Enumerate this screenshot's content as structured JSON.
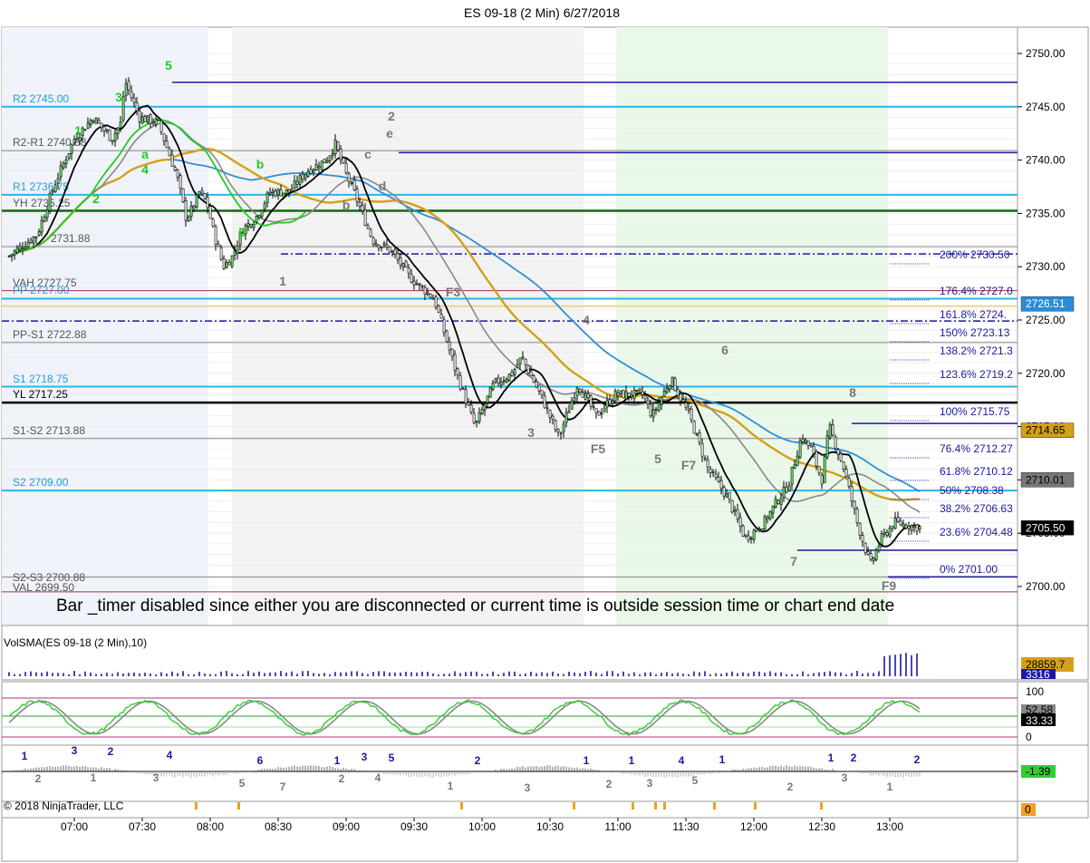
{
  "header": {
    "title": "ES 09-18 (2 Min)  6/27/2018"
  },
  "notice": "Bar _timer disabled since either you are disconnected or current time is outside session time or chart end date",
  "copyright": "© 2018 NinjaTrader, LLC",
  "chart_data": {
    "type": "candlestick",
    "price_axis": {
      "ylim": [
        2699.5,
        2751.5
      ],
      "ticks": [
        2700.0,
        2705.0,
        2710.0,
        2715.0,
        2720.0,
        2725.0,
        2730.0,
        2735.0,
        2740.0,
        2745.0,
        2750.0
      ]
    },
    "time_axis": {
      "ticks": [
        "07:00",
        "07:30",
        "08:00",
        "08:30",
        "09:00",
        "09:30",
        "10:00",
        "10:30",
        "11:00",
        "11:30",
        "12:00",
        "12:30",
        "13:00"
      ]
    },
    "price_badges": [
      {
        "label": "2726.51",
        "price": 2726.51,
        "bg": "#2a8cd9",
        "fg": "#ffffff"
      },
      {
        "label": "2714.65",
        "price": 2714.65,
        "bg": "#d4a017",
        "fg": "#000000"
      },
      {
        "label": "2710.01",
        "price": 2710.01,
        "bg": "#777777",
        "fg": "#000000"
      },
      {
        "label": "2705.50",
        "price": 2705.5,
        "bg": "#000000",
        "fg": "#ffffff"
      }
    ],
    "levels": [
      {
        "label": "R2 2745.00",
        "price": 2745.0,
        "color": "#29b6e8"
      },
      {
        "label": "R2-R1 2740.88",
        "price": 2740.88,
        "color": "#888888"
      },
      {
        "label": "R1 2736.75",
        "price": 2736.75,
        "color": "#29b6e8"
      },
      {
        "label": "YH 2735.25",
        "price": 2735.25,
        "color": "#0d6b0d"
      },
      {
        "label": "2731.88",
        "price": 2731.88,
        "color": "#888888"
      },
      {
        "label": "VAH 2727.75",
        "price": 2727.75,
        "color": "#a0305a"
      },
      {
        "label": "PP 2727.00",
        "price": 2727.0,
        "color": "#29b6e8"
      },
      {
        "label": "PP-S1 2722.88",
        "price": 2722.88,
        "color": "#888888"
      },
      {
        "label": "S1 2718.75",
        "price": 2718.75,
        "color": "#29b6e8"
      },
      {
        "label": "YL 2717.25",
        "price": 2717.25,
        "color": "#000000"
      },
      {
        "label": "S1-S2 2713.88",
        "price": 2713.88,
        "color": "#888888"
      },
      {
        "label": "S2 2709.00",
        "price": 2709.0,
        "color": "#29b6e8"
      },
      {
        "label": "S2-S3 2700.88",
        "price": 2700.88,
        "color": "#888888"
      },
      {
        "label": "VAL 2699.50",
        "price": 2699.5,
        "color": "#a0305a"
      }
    ],
    "fib_levels": [
      {
        "label": "200%",
        "value": "2730.50"
      },
      {
        "label": "176.4%",
        "value": "2727.0"
      },
      {
        "label": "161.8%",
        "value": "2724."
      },
      {
        "label": "150%",
        "value": "2723.13"
      },
      {
        "label": "138.2%",
        "value": "2721.3"
      },
      {
        "label": "123.6%",
        "value": "2719.2"
      },
      {
        "label": "100%",
        "value": "2715.75"
      },
      {
        "label": "76.4%",
        "value": "2712.27"
      },
      {
        "label": "61.8%",
        "value": "2710.12"
      },
      {
        "label": "50%",
        "value": "2708.38"
      },
      {
        "label": "38.2%",
        "value": "2706.63"
      },
      {
        "label": "23.6%",
        "value": "2704.48"
      },
      {
        "label": "0%",
        "value": "2701.00"
      }
    ],
    "wave_marks": [
      {
        "text": "5",
        "color": "#22cc22"
      },
      {
        "text": "3",
        "color": "#22cc22"
      },
      {
        "text": "1",
        "color": "#22cc22"
      },
      {
        "text": "a",
        "color": "#22cc22"
      },
      {
        "text": "4",
        "color": "#22cc22"
      },
      {
        "text": "2",
        "color": "#22cc22"
      },
      {
        "text": "b",
        "color": "#22cc22"
      },
      {
        "text": "6",
        "color": "#22cc22"
      },
      {
        "text": "2",
        "color": "#777777"
      },
      {
        "text": "e",
        "color": "#777777"
      },
      {
        "text": "c",
        "color": "#777777"
      },
      {
        "text": "d",
        "color": "#777777"
      },
      {
        "text": "b",
        "color": "#777777"
      },
      {
        "text": "1",
        "color": "#777777"
      },
      {
        "text": "F3",
        "color": "#777777"
      },
      {
        "text": "3",
        "color": "#777777"
      },
      {
        "text": "4",
        "color": "#777777"
      },
      {
        "text": "F5",
        "color": "#777777"
      },
      {
        "text": "5",
        "color": "#777777"
      },
      {
        "text": "F7",
        "color": "#777777"
      },
      {
        "text": "6",
        "color": "#777777"
      },
      {
        "text": "7",
        "color": "#777777"
      },
      {
        "text": "8",
        "color": "#777777"
      },
      {
        "text": "F9",
        "color": "#777777"
      }
    ],
    "panels": [
      {
        "name": "volume",
        "label": "VolSMA(ES 09-18 (2 Min),10)",
        "badges": [
          "28859.7",
          "3316"
        ]
      },
      {
        "name": "stochastic",
        "ticks": [
          "100",
          "0"
        ],
        "badges": [
          "52.58",
          "33.33"
        ]
      },
      {
        "name": "oscillator",
        "badges": [
          "-1.39"
        ]
      },
      {
        "name": "markers",
        "badges": [
          "0"
        ]
      }
    ],
    "osc_wave_labels": [
      "1",
      "2",
      "3",
      "1",
      "2",
      "3",
      "4",
      "5",
      "6",
      "7",
      "1",
      "2",
      "3",
      "4",
      "5",
      "1",
      "2",
      "3",
      "1",
      "2",
      "1",
      "3",
      "4",
      "5",
      "1",
      "2",
      "1",
      "3",
      "2",
      "1",
      "2"
    ]
  }
}
